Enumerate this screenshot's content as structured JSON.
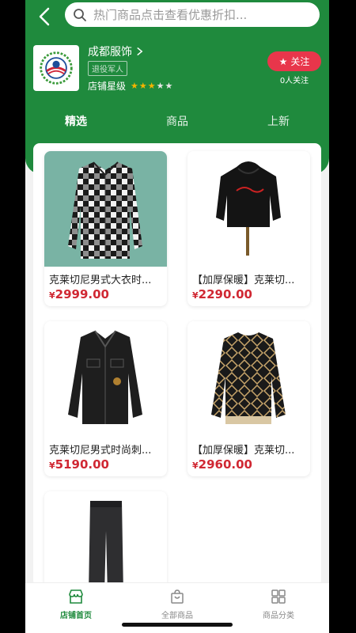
{
  "search": {
    "placeholder": "热门商品点击查看优惠折扣..."
  },
  "shop": {
    "name": "成都服饰",
    "badge": "退役军人",
    "rating_label": "店铺星级",
    "stars": 5,
    "stars_filled": 3,
    "follow_label": "关注",
    "followers": "0人关注"
  },
  "tabs": [
    {
      "label": "精选",
      "active": true
    },
    {
      "label": "商品",
      "active": false
    },
    {
      "label": "上新",
      "active": false
    }
  ],
  "products": [
    {
      "title": "克莱切尼男式大衣时...",
      "currency": "¥",
      "price": "2999.00",
      "image": "plaid-jacket"
    },
    {
      "title": "【加厚保暖】克莱切...",
      "currency": "¥",
      "price": "2290.00",
      "image": "black-hoodie"
    },
    {
      "title": "克莱切尼男式时尚刺...",
      "currency": "¥",
      "price": "5190.00",
      "image": "denim-jacket"
    },
    {
      "title": "【加厚保暖】克莱切...",
      "currency": "¥",
      "price": "2960.00",
      "image": "pattern-sweater"
    },
    {
      "title": "",
      "currency": "",
      "price": "",
      "image": "jeans"
    }
  ],
  "nav": [
    {
      "label": "店铺首页",
      "icon": "store-icon",
      "active": true
    },
    {
      "label": "全部商品",
      "icon": "bag-icon",
      "active": false
    },
    {
      "label": "商品分类",
      "icon": "grid-icon",
      "active": false
    }
  ],
  "colors": {
    "primary": "#1f8a3d",
    "price": "#d02833",
    "follow": "#e8364b",
    "star": "#f5b400"
  }
}
